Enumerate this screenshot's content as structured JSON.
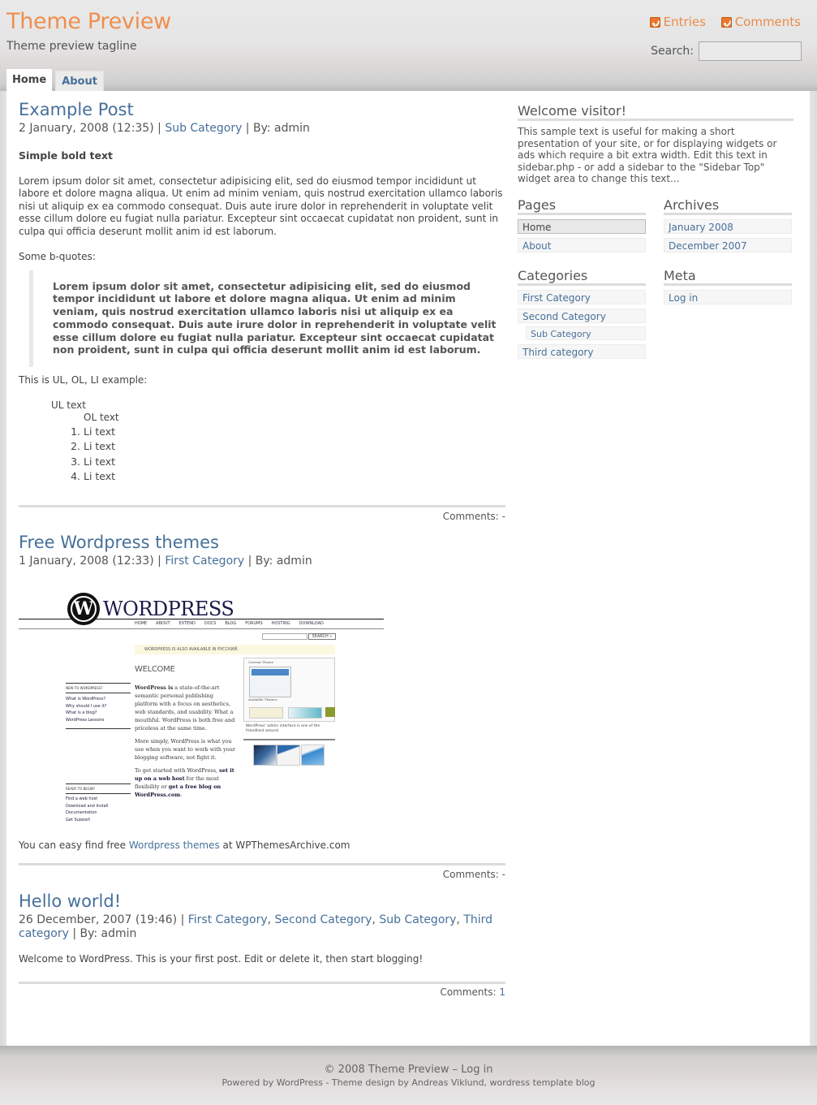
{
  "header": {
    "site_title": "Theme Preview",
    "tagline": "Theme preview tagline",
    "feeds": [
      {
        "label": "Entries",
        "icon": "rss-icon"
      },
      {
        "label": "Comments",
        "icon": "rss-icon"
      }
    ],
    "search": {
      "label": "Search:",
      "value": "",
      "placeholder": ""
    },
    "tabs": [
      {
        "label": "Home",
        "active": true
      },
      {
        "label": "About",
        "active": false
      }
    ]
  },
  "posts": [
    {
      "title": "Example Post",
      "date": "2 January, 2008 (12:35)",
      "sep1": " | ",
      "category": "Sub Category",
      "by": " | By: admin",
      "bold_text": "Simple bold text",
      "paragraph": "Lorem ipsum dolor sit amet, consectetur adipisicing elit, sed do eiusmod tempor incididunt ut labore et dolore magna aliqua. Ut enim ad minim veniam, quis nostrud exercitation ullamco laboris nisi ut aliquip ex ea commodo consequat. Duis aute irure dolor in reprehenderit in voluptate velit esse cillum dolore eu fugiat nulla pariatur. Excepteur sint occaecat cupidatat non proident, sunt in culpa qui officia deserunt mollit anim id est laborum.",
      "bquote_intro": "Some b-quotes:",
      "blockquote": "Lorem ipsum dolor sit amet, consectetur adipisicing elit, sed do eiusmod tempor incididunt ut labore et dolore magna aliqua. Ut enim ad minim veniam, quis nostrud exercitation ullamco laboris nisi ut aliquip ex ea commodo consequat. Duis aute irure dolor in reprehenderit in voluptate velit esse cillum dolore eu fugiat nulla pariatur. Excepteur sint occaecat cupidatat non proident, sunt in culpa qui officia deserunt mollit anim id est laborum.",
      "list_intro": "This is UL, OL, LI example:",
      "ul_text": "UL text",
      "ol_text": "OL text",
      "li_items": [
        "Li text",
        "Li text",
        "Li text",
        "Li text"
      ],
      "comments_label": "Comments: ",
      "comments_value": "-"
    },
    {
      "title": "Free Wordpress themes",
      "date": "1 January, 2008 (12:33)",
      "sep1": " | ",
      "category": "First Category",
      "by": " | By: admin",
      "text_before": "You can easy find free ",
      "link_text": "Wordpress themes",
      "text_after": " at WPThemesArchive.com",
      "comments_label": "Comments: ",
      "comments_value": "-",
      "screenshot": {
        "logo_text": "WORDPRESS",
        "nav": [
          "HOME",
          "ABOUT",
          "EXTEND",
          "DOCS",
          "BLOG",
          "FORUMS",
          "HOSTING",
          "DOWNLOAD"
        ],
        "search_button": "SEARCH »",
        "notice": "WORDPRESS IS ALSO AVAILABLE IN РУССКИЙ.",
        "welcome": "WELCOME",
        "new_heading": "NEW TO WORDPRESS?",
        "new_links": [
          "What is WordPress?",
          "Why should I use it?",
          "What is a blog?",
          "WordPress Lessons"
        ],
        "ready_heading": "READY TO BEGIN?",
        "ready_links": [
          "Find a web host",
          "Download and Install",
          "Documentation",
          "Get Support"
        ],
        "p1_bold": "WordPress is",
        "p1": " a state-of-the-art semantic personal publishing platform with a focus on aesthetics, web standards, and usability. What a mouthful. WordPress is both free and priceless at the same time.",
        "p2": "More simply, WordPress is what you use when you want to work with your blogging software, not fight it.",
        "p3_a": "To get started with WordPress, ",
        "p3_link1": "set it up on a web host",
        "p3_b": " for the most flexibility or ",
        "p3_link2": "get a free blog on WordPress.com",
        "p3_c": ".",
        "current_theme": "Current Theme",
        "available_themes": "Available Themes",
        "caption": "WordPress' admin interface is one of the friendliest around."
      }
    },
    {
      "title": "Hello world!",
      "date": "26 December, 2007 (19:46)",
      "sep1": " | ",
      "categories": [
        "First Category",
        "Second Category",
        "Sub Category",
        "Third category"
      ],
      "by": " | By: admin",
      "body": "Welcome to WordPress. This is your first post. Edit or delete it, then start blogging!",
      "comments_label": "Comments: ",
      "comments_value": "1"
    }
  ],
  "sidebar": {
    "welcome_title": "Welcome visitor!",
    "welcome_text": "This sample text is useful for making a short presentation of your site, or for displaying widgets or ads which require a bit extra width. Edit this text in sidebar.php - or add a sidebar to the \"Sidebar Top\" widget area to change this text...",
    "pages_title": "Pages",
    "pages": [
      {
        "label": "Home",
        "current": true
      },
      {
        "label": "About",
        "current": false
      }
    ],
    "archives_title": "Archives",
    "archives": [
      "January 2008",
      "December 2007"
    ],
    "categories_title": "Categories",
    "categories": [
      {
        "label": "First Category",
        "sub": false
      },
      {
        "label": "Second Category",
        "sub": false
      },
      {
        "label": "Sub Category",
        "sub": true
      },
      {
        "label": "Third category",
        "sub": false
      }
    ],
    "meta_title": "Meta",
    "meta": [
      "Log in"
    ]
  },
  "footer": {
    "copyright": "© 2008 Theme Preview",
    "dash": " – ",
    "login": "Log in",
    "powered_by": "Powered by WordPress",
    "design_sep": " - Theme design by ",
    "designer": "Andreas Viklund",
    "comma": ", ",
    "template_blog": "wordress template blog"
  },
  "colors": {
    "title_orange": "#ee8f4f",
    "link_blue": "#47709a",
    "text_gray": "#444444",
    "separator": "#dcdcdc"
  }
}
